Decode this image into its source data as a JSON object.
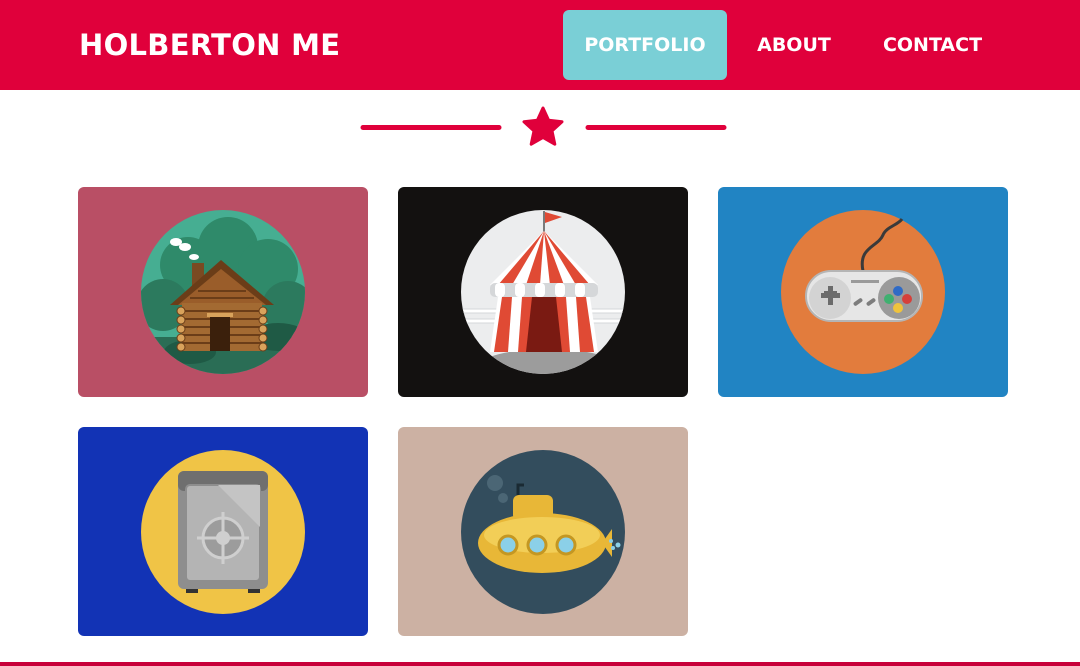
{
  "navbar": {
    "brand": "HOLBERTON ME",
    "links": [
      {
        "label": "PORTFOLIO",
        "active": true
      },
      {
        "label": "ABOUT",
        "active": false
      },
      {
        "label": "CONTACT",
        "active": false
      }
    ]
  },
  "colors": {
    "brand": "#e0003b",
    "active_tab": "#7acfd6"
  },
  "portfolio": {
    "items": [
      {
        "icon": "log-cabin-icon",
        "background": "#b94f65",
        "circle": "#46ae92"
      },
      {
        "icon": "circus-tent-icon",
        "background": "#131110",
        "circle": "#ecedee"
      },
      {
        "icon": "game-controller-icon",
        "background": "#2184c3",
        "circle": "#e27c3d"
      },
      {
        "icon": "safe-icon",
        "background": "#1233b5",
        "circle": "#f0c446"
      },
      {
        "icon": "submarine-icon",
        "background": "#ccb1a3",
        "circle": "#334d5d"
      }
    ]
  }
}
